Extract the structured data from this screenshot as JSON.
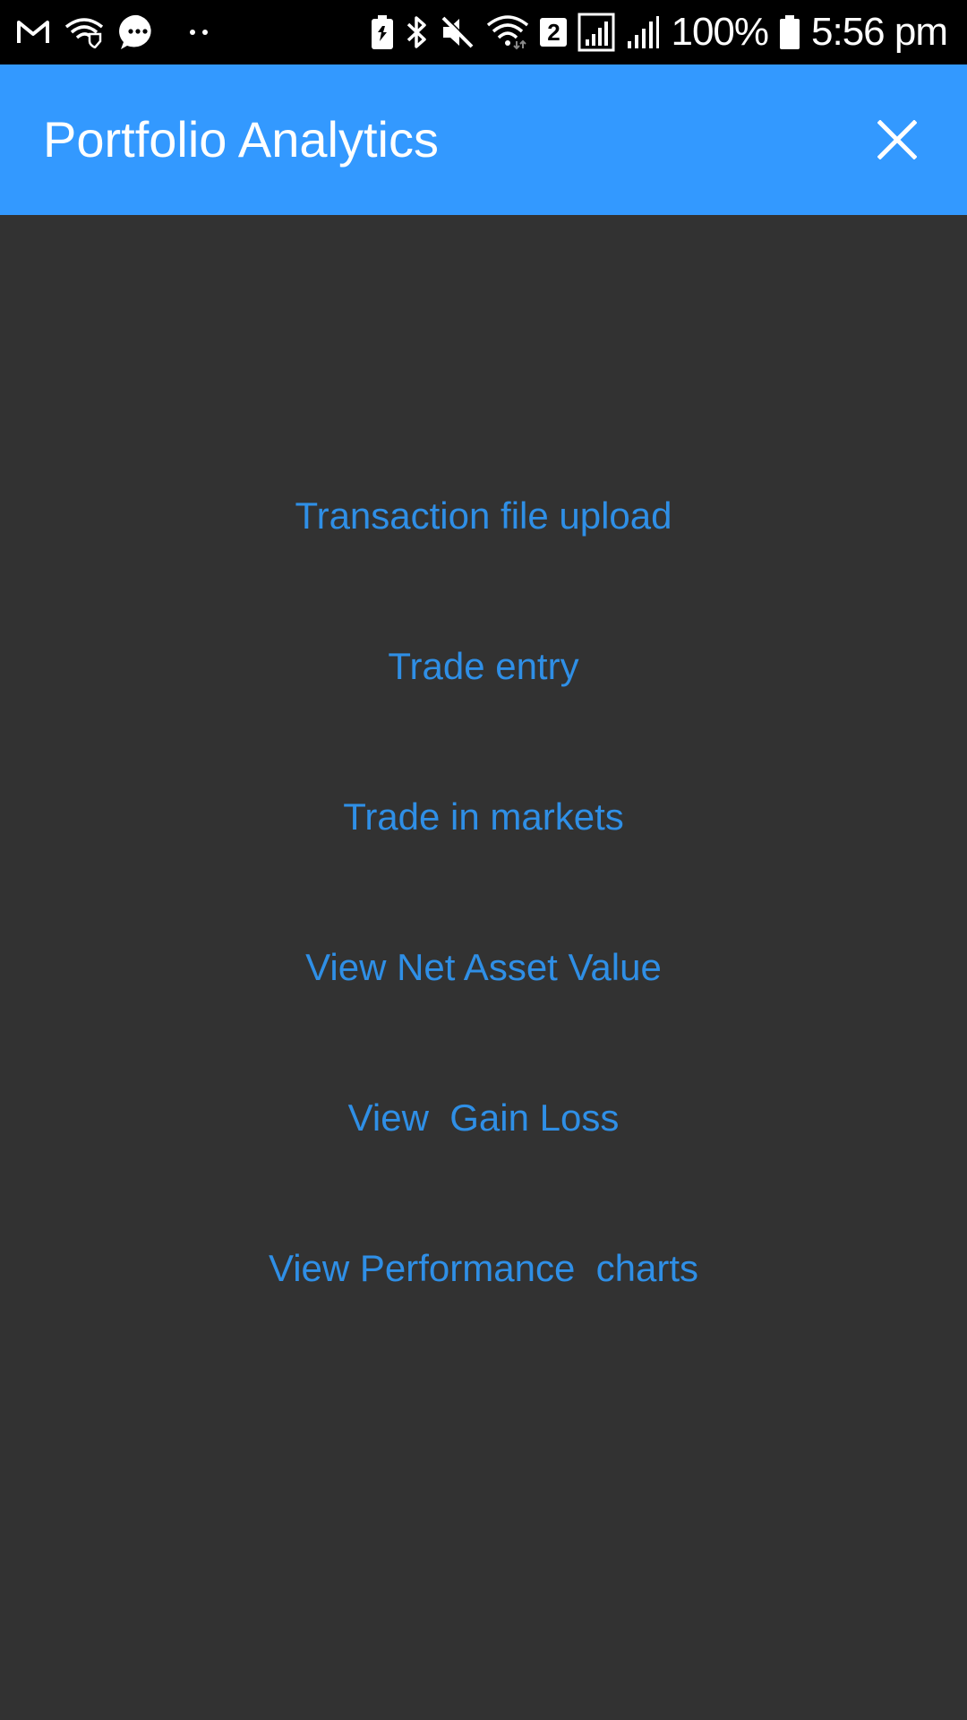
{
  "status_bar": {
    "left_icons": [
      "gmail-icon",
      "wifi-shield-icon",
      "messages-icon",
      "more-dots-icon"
    ],
    "right_icons": [
      "battery-saver-icon",
      "bluetooth-icon",
      "mute-icon",
      "wifi-icon",
      "sim-badge",
      "signal-icon",
      "signal-icon-2",
      "battery-icon"
    ],
    "sim_number": "2",
    "battery_percent": "100%",
    "time": "5:56 pm"
  },
  "app_bar": {
    "title": "Portfolio Analytics",
    "close_icon": "close-icon",
    "background": "#3399ff"
  },
  "menu": {
    "items": [
      {
        "label": "Transaction file upload"
      },
      {
        "label": "Trade entry"
      },
      {
        "label": "Trade in markets"
      },
      {
        "label": "View Net Asset Value"
      },
      {
        "label": "View  Gain Loss"
      },
      {
        "label": "View Performance  charts"
      }
    ],
    "link_color": "#2f8fe6"
  },
  "colors": {
    "background": "#323232",
    "status_bar": "#000000",
    "accent": "#3399ff"
  }
}
